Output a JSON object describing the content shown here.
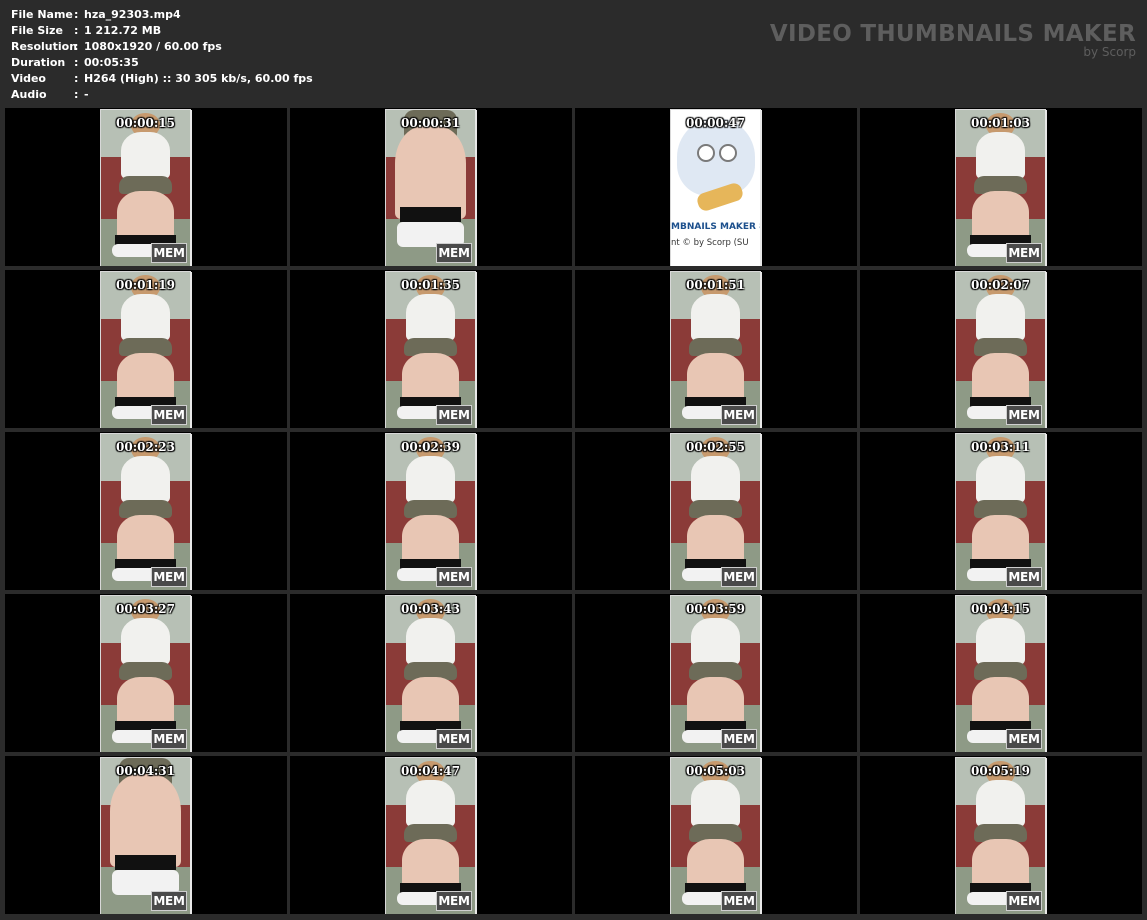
{
  "meta": {
    "rows": [
      {
        "label": "File Name",
        "sep": ":",
        "value": "hza_92303.mp4"
      },
      {
        "label": "File Size",
        "sep": ":",
        "value": "1 212.72 MB"
      },
      {
        "label": "Resolution",
        "sep": ":",
        "value": "1080x1920 / 60.00 fps"
      },
      {
        "label": "Duration",
        "sep": ":",
        "value": "00:05:35"
      },
      {
        "label": "Video",
        "sep": ":",
        "value": "H264 (High) :: 30 305 kb/s, 60.00 fps"
      },
      {
        "label": "Audio",
        "sep": ":",
        "value": "-"
      }
    ]
  },
  "brand": {
    "title": "VIDEO THUMBNAILS MAKER",
    "subtitle": "by Scorp"
  },
  "colors": {
    "background": "#2b2b2b",
    "cell": "#000000",
    "brand_text": "#5e5e5e",
    "wall": "#b7c0b5",
    "seat": "#8b3b38",
    "floor": "#8e9a86"
  },
  "thumbnails": [
    {
      "time": "00:00:15",
      "badge": "MEM",
      "kind": "seated"
    },
    {
      "time": "00:00:31",
      "badge": "MEM",
      "kind": "closeup"
    },
    {
      "time": "00:00:47",
      "kind": "logo",
      "logo_line1": "MBNAILS MAKER 8",
      "logo_line2": "nt © by Scorp (SU"
    },
    {
      "time": "00:01:03",
      "badge": "MEM",
      "kind": "seated"
    },
    {
      "time": "00:01:19",
      "badge": "MEM",
      "kind": "seated"
    },
    {
      "time": "00:01:35",
      "badge": "MEM",
      "kind": "seated"
    },
    {
      "time": "00:01:51",
      "badge": "MEM",
      "kind": "seated"
    },
    {
      "time": "00:02:07",
      "badge": "MEM",
      "kind": "seated"
    },
    {
      "time": "00:02:23",
      "badge": "MEM",
      "kind": "seated"
    },
    {
      "time": "00:02:39",
      "badge": "MEM",
      "kind": "seated"
    },
    {
      "time": "00:02:55",
      "badge": "MEM",
      "kind": "seated"
    },
    {
      "time": "00:03:11",
      "badge": "MEM",
      "kind": "seated"
    },
    {
      "time": "00:03:27",
      "badge": "MEM",
      "kind": "seated"
    },
    {
      "time": "00:03:43",
      "badge": "MEM",
      "kind": "seated"
    },
    {
      "time": "00:03:59",
      "badge": "MEM",
      "kind": "seated"
    },
    {
      "time": "00:04:15",
      "badge": "MEM",
      "kind": "seated"
    },
    {
      "time": "00:04:31",
      "badge": "MEM",
      "kind": "closeup"
    },
    {
      "time": "00:04:47",
      "badge": "MEM",
      "kind": "seated"
    },
    {
      "time": "00:05:03",
      "badge": "MEM",
      "kind": "seated"
    },
    {
      "time": "00:05:19",
      "badge": "MEM",
      "kind": "seated"
    }
  ]
}
